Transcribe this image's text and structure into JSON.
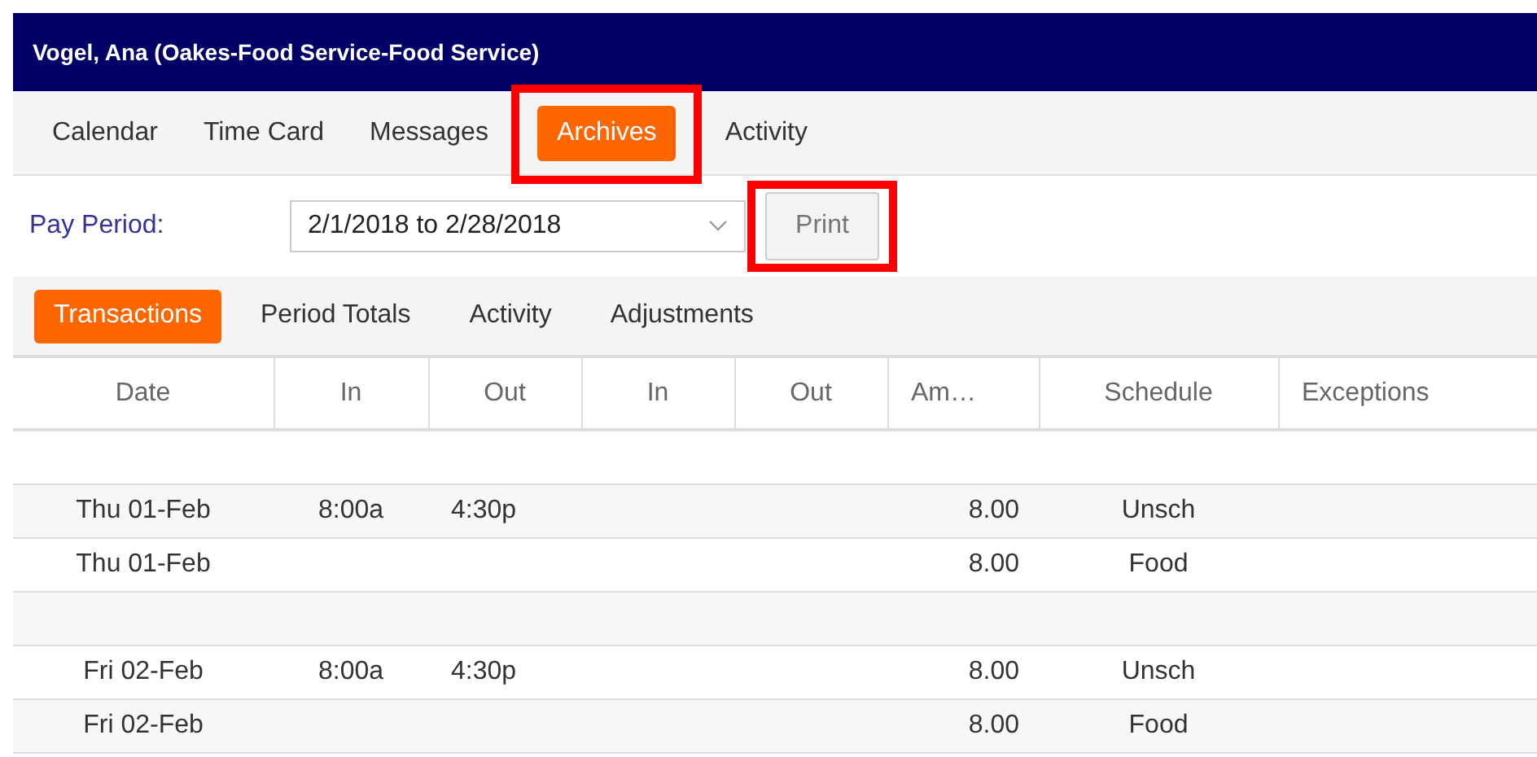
{
  "window": {
    "title": "Vogel, Ana (Oakes-Food Service-Food Service)"
  },
  "tabs": [
    {
      "label": "Calendar",
      "selected": false,
      "highlighted": false
    },
    {
      "label": "Time Card",
      "selected": false,
      "highlighted": false
    },
    {
      "label": "Messages",
      "selected": false,
      "highlighted": false
    },
    {
      "label": "Archives",
      "selected": true,
      "highlighted": true
    },
    {
      "label": "Activity",
      "selected": false,
      "highlighted": false
    }
  ],
  "pay_period": {
    "label": "Pay Period:",
    "value": "2/1/2018 to 2/28/2018"
  },
  "print_button": {
    "label": "Print",
    "highlighted": true
  },
  "subtabs": [
    {
      "label": "Transactions",
      "selected": true
    },
    {
      "label": "Period Totals",
      "selected": false
    },
    {
      "label": "Activity",
      "selected": false
    },
    {
      "label": "Adjustments",
      "selected": false
    }
  ],
  "table": {
    "columns": [
      "Date",
      "In",
      "Out",
      "In",
      "Out",
      "Am…",
      "Schedule",
      "Exceptions"
    ],
    "rows": [
      [
        "",
        "",
        "",
        "",
        "",
        "",
        "",
        ""
      ],
      [
        "Thu 01-Feb",
        "8:00a",
        "4:30p",
        "",
        "",
        "8.00",
        "Unsch",
        ""
      ],
      [
        "Thu 01-Feb",
        "",
        "",
        "",
        "",
        "8.00",
        "Food",
        ""
      ],
      [
        "",
        "",
        "",
        "",
        "",
        "",
        "",
        ""
      ],
      [
        "Fri 02-Feb",
        "8:00a",
        "4:30p",
        "",
        "",
        "8.00",
        "Unsch",
        ""
      ],
      [
        "Fri 02-Feb",
        "",
        "",
        "",
        "",
        "8.00",
        "Food",
        ""
      ]
    ]
  }
}
